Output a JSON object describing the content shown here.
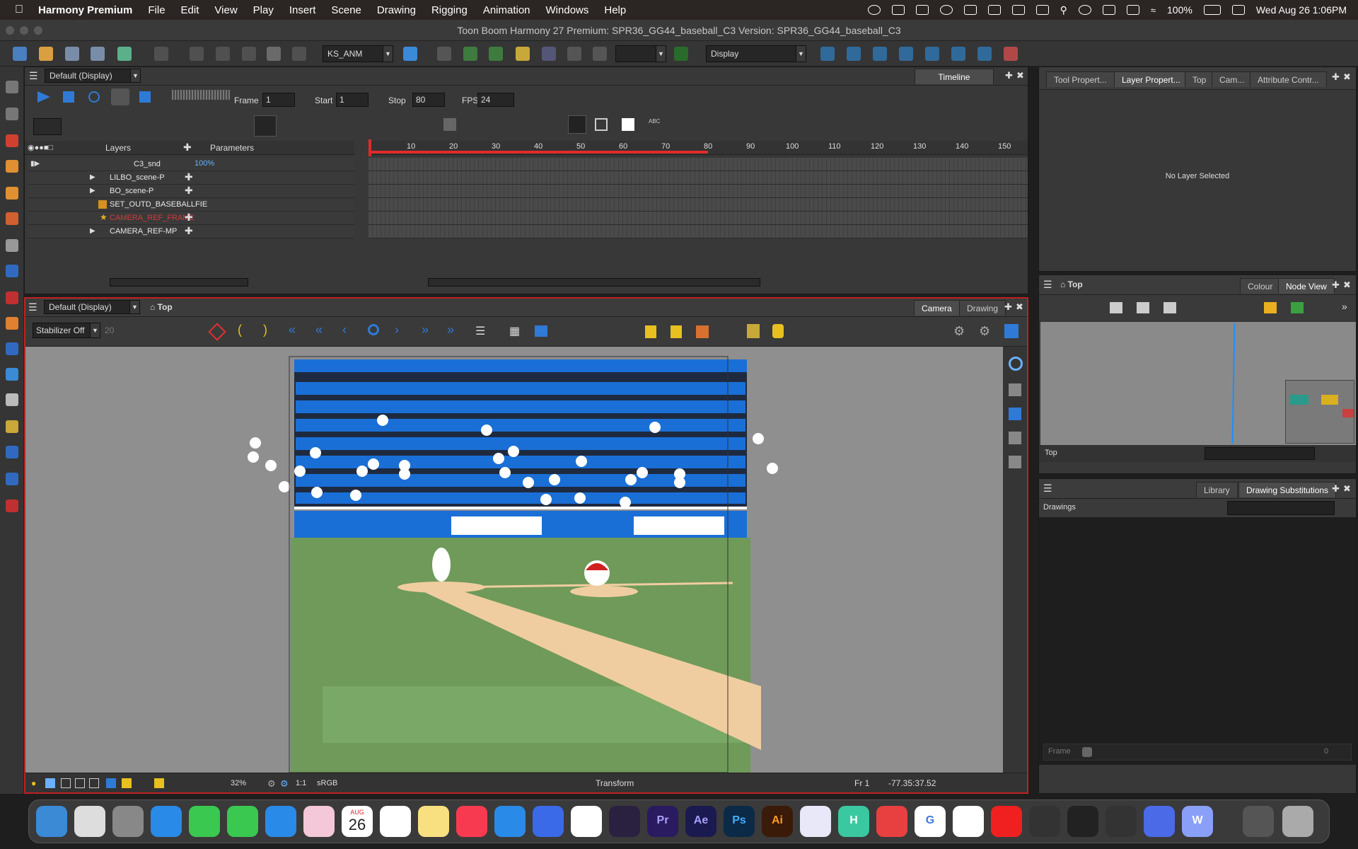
{
  "menubar": {
    "app_name": "Harmony Premium",
    "items": [
      "File",
      "Edit",
      "View",
      "Play",
      "Insert",
      "Scene",
      "Drawing",
      "Rigging",
      "Animation",
      "Windows",
      "Help"
    ],
    "battery": "100%",
    "datetime": "Wed Aug 26  1:06PM"
  },
  "window": {
    "title": "Toon Boom Harmony 27 Premium: SPR36_GG44_baseball_C3 Version: SPR36_GG44_baseball_C3"
  },
  "main_toolbar": {
    "workspace": "KS_ANM",
    "display": "Display"
  },
  "timeline": {
    "view_combo": "Default (Display)",
    "header_tab": "Timeline",
    "frame_label": "Frame",
    "frame_value": "1",
    "start_label": "Start",
    "start_value": "1",
    "stop_label": "Stop",
    "stop_value": "80",
    "fps_label": "FPS",
    "fps_value": "24",
    "layers_col": "Layers",
    "params_col": "Parameters",
    "zoom_value": "100%",
    "ticks": [
      "10",
      "20",
      "30",
      "40",
      "50",
      "60",
      "70",
      "80",
      "90",
      "100",
      "110",
      "120",
      "130",
      "140",
      "150"
    ],
    "layers": [
      {
        "name": "C3_snd",
        "color": "#e8e8e8"
      },
      {
        "name": "LILBO_scene-P",
        "color": "#e8e8e8"
      },
      {
        "name": "BO_scene-P",
        "color": "#e8e8e8"
      },
      {
        "name": "SET_OUTD_BASEBALLFIE",
        "color": "#e8e8e8"
      },
      {
        "name": "CAMERA_REF_FRAME",
        "color": "#d33a3a"
      },
      {
        "name": "CAMERA_REF-MP",
        "color": "#e8e8e8"
      }
    ]
  },
  "camera_view": {
    "view_combo": "Default (Display)",
    "breadcrumb": "Top",
    "tab_camera": "Camera",
    "tab_drawing": "Drawing",
    "stabilizer": "Stabilizer Off",
    "stabilizer_value": "20",
    "status": {
      "zoom": "32%",
      "ratio": "1:1",
      "colorspace": "sRGB",
      "tool": "Transform",
      "frame": "Fr 1",
      "coords": "-77.35:37.52"
    }
  },
  "right_panels": {
    "top_tabs": [
      "Tool Propert...",
      "Layer Propert...",
      "Top",
      "Cam...",
      "Attribute Contr..."
    ],
    "no_layer": "No Layer Selected",
    "node_breadcrumb": "Top",
    "node_tabs": [
      "Colour",
      "Node View"
    ],
    "node_footer": "Top",
    "lib_tabs": [
      "Library",
      "Drawing Substitutions"
    ],
    "drawings_label": "Drawings",
    "frame_label": "Frame",
    "frame_value": "0"
  },
  "dock": {
    "calendar_month": "AUG",
    "calendar_day": "26",
    "apps": [
      "finder",
      "launchpad",
      "settings",
      "safari",
      "messages",
      "facetime",
      "mail",
      "photos",
      "calendar",
      "reminders",
      "notes",
      "music",
      "app-store",
      "tasks",
      "notion",
      "arc",
      "premiere-pro",
      "after-effects",
      "photoshop",
      "illustrator",
      "keynote",
      "harmony",
      "toon-boom",
      "google",
      "trendy",
      "youtube",
      "perplexity",
      "pause",
      "tourbox",
      "ipad",
      "word"
    ],
    "labels": {
      "premiere-pro": "Pr",
      "after-effects": "Ae",
      "photoshop": "Ps",
      "illustrator": "Ai",
      "harmony": "H",
      "google": "G",
      "word": "W"
    }
  },
  "colors": {
    "accent_red": "#e02a2a",
    "stadium_blue": "#1a6fd6",
    "grass_green": "#6f9a5a",
    "dirt": "#f0cda0"
  }
}
